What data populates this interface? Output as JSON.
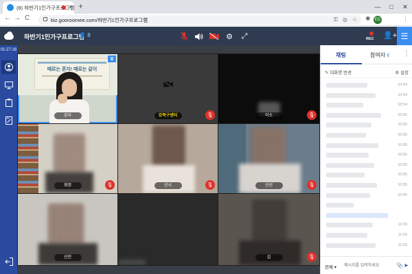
{
  "browser": {
    "tab_title": "(8) 하반기1인가구프로그램",
    "new_tab": "+",
    "tab_close": "×",
    "url": "biz.gooroomee.com/하반기1인가구프로그램",
    "profile_initials": "ED",
    "min": "—",
    "max": "□",
    "close": "✕",
    "back": "←",
    "forward": "→",
    "reload": "C"
  },
  "header": {
    "room_title": "하반기1인가구프로그램",
    "user_count": "8",
    "rec_label": "REC",
    "colors": {
      "bar": "#2f3b50",
      "accent": "#3b8ef0",
      "danger": "#e0312b"
    }
  },
  "sidebar": {
    "timer": "01:27:16",
    "items": [
      {
        "name": "participant-icon"
      },
      {
        "name": "screen-share-icon"
      },
      {
        "name": "document-icon"
      },
      {
        "name": "whiteboard-icon"
      },
      {
        "name": "exit-icon"
      }
    ]
  },
  "video": {
    "tiles": [
      {
        "name": "강사",
        "banner": "때로는 혼자! 때로는 같이",
        "muted": false,
        "host": true,
        "active": true
      },
      {
        "name": "강북구센터",
        "muted": true,
        "camera_off": true,
        "highlight": true
      },
      {
        "name": "이소",
        "muted": true
      },
      {
        "name": "최정",
        "muted": true
      },
      {
        "name": "신시",
        "muted": true
      },
      {
        "name": "신선",
        "muted": true
      },
      {
        "name": "신민",
        "muted": true
      },
      {
        "name": "",
        "muted": false
      },
      {
        "name": "김",
        "muted": true
      }
    ]
  },
  "chat": {
    "tab_chat": "채팅",
    "tab_participants": "참여자",
    "participants_count": "8",
    "sub_left": "대화명 변경",
    "sub_right": "설정",
    "messages": [
      {
        "time": "10:54"
      },
      {
        "time": "10:54"
      },
      {
        "time": "10:54"
      },
      {
        "time": "10:55"
      },
      {
        "time": "10:55"
      },
      {
        "time": "10:55"
      },
      {
        "time": "10:55"
      },
      {
        "time": "10:55"
      },
      {
        "time": "10:55"
      },
      {
        "time": "10:55"
      },
      {
        "time": "10:55"
      },
      {
        "time": "10:55"
      },
      {
        "time": ""
      },
      {
        "time": ""
      },
      {
        "time": "11:03"
      },
      {
        "time": "11:03"
      },
      {
        "time": "11:03"
      }
    ],
    "scope": "전체",
    "input_placeholder": "메시지를 입력하세요",
    "more": "⋮"
  }
}
